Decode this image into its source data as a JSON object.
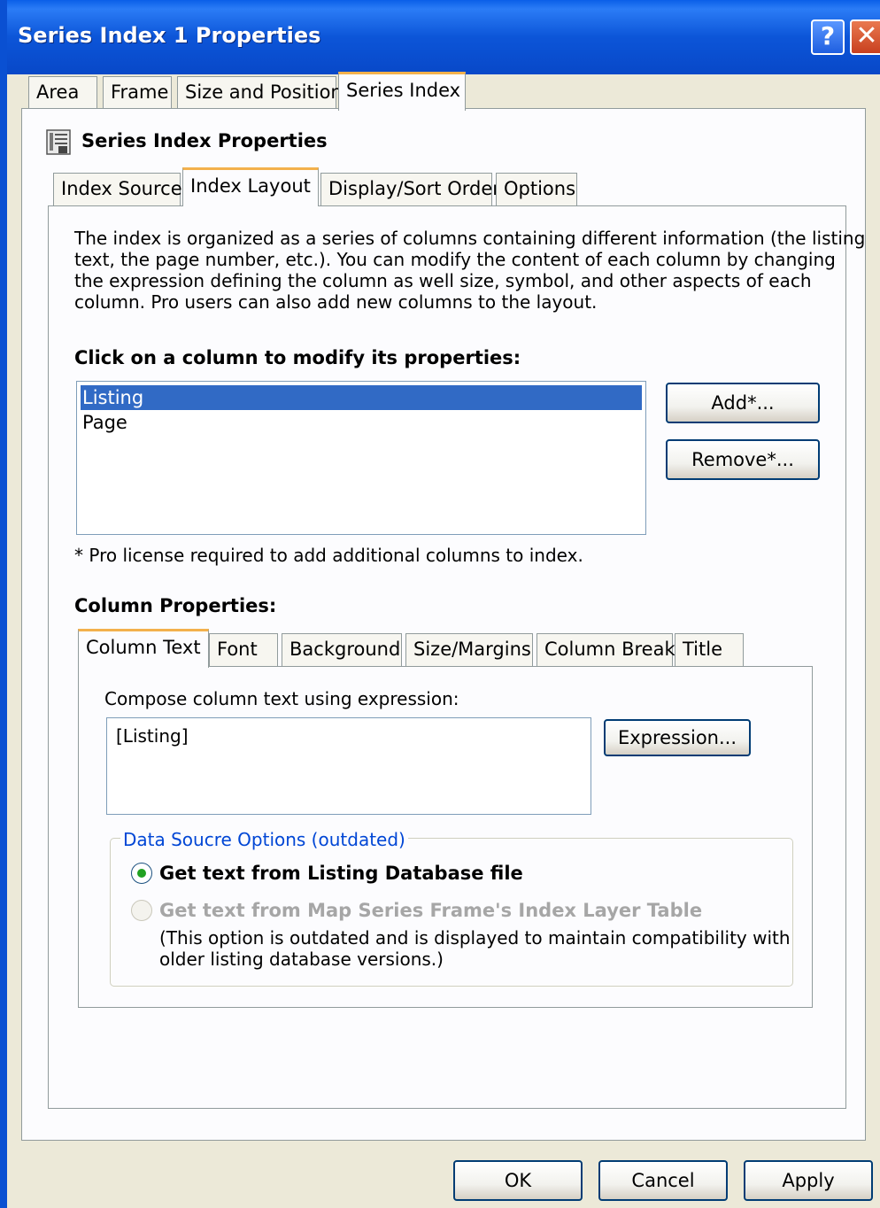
{
  "window": {
    "title": "Series Index 1 Properties",
    "help_glyph": "?",
    "close_glyph": "✕"
  },
  "outer_tabs": [
    {
      "label": "Area"
    },
    {
      "label": "Frame"
    },
    {
      "label": "Size and Position"
    },
    {
      "label": "Series Index"
    }
  ],
  "section": {
    "title": "Series Index Properties",
    "icon": "series-index-icon"
  },
  "inner_tabs": [
    {
      "label": "Index Source"
    },
    {
      "label": "Index Layout"
    },
    {
      "label": "Display/Sort Order"
    },
    {
      "label": "Options"
    }
  ],
  "description": [
    "The index is organized as a series of columns containing different information (the listing",
    "text, the page number, etc.).  You can modify the content of each column by changing",
    "the expression defining the column as well size, symbol, and other aspects of each",
    "column.  Pro users can also add new columns to the layout."
  ],
  "columns_section": {
    "heading": "Click on a column to modify its properties:",
    "items": [
      "Listing",
      "Page"
    ],
    "selected": "Listing",
    "add_label": "Add*...",
    "remove_label": "Remove*...",
    "note": "* Pro license required to add additional columns to index."
  },
  "column_properties": {
    "heading": "Column Properties:",
    "tabs": [
      {
        "label": "Column Text"
      },
      {
        "label": "Font"
      },
      {
        "label": "Background"
      },
      {
        "label": "Size/Margins"
      },
      {
        "label": "Column Break"
      },
      {
        "label": "Title"
      }
    ],
    "compose_label": "Compose column text using expression:",
    "expression_value": "[Listing]",
    "expression_button": "Expression...",
    "data_source": {
      "legend": "Data Soucre Options (outdated)",
      "option1": "Get text from Listing Database file",
      "option2": "Get text from Map Series Frame's Index Layer Table",
      "note_line1": "(This option is outdated and is displayed to maintain compatibility with",
      "note_line2": "older listing database versions.)"
    }
  },
  "footer": {
    "ok": "OK",
    "cancel": "Cancel",
    "apply": "Apply"
  }
}
